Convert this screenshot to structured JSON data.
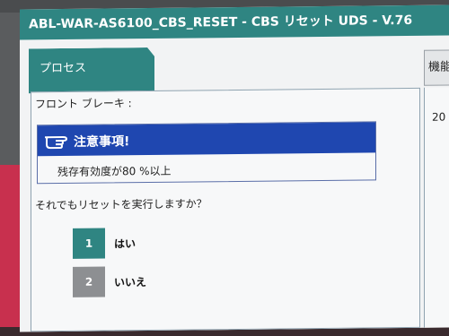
{
  "window": {
    "title": "ABL-WAR-AS6100_CBS_RESET - CBS リセット UDS - V.76"
  },
  "tabs": {
    "process_label": "プロセス",
    "right_tab_label": "機能"
  },
  "side_panel": {
    "value": "20"
  },
  "main": {
    "section_label": "フロント ブレーキ :",
    "warning": {
      "title": "注意事項!",
      "message": "残存有効度が80 %以上",
      "icon": "pointing-hand-icon"
    },
    "question": "それでもリセットを実行しますか？",
    "options": [
      {
        "number": "1",
        "label": "はい"
      },
      {
        "number": "2",
        "label": "いいえ"
      }
    ]
  },
  "colors": {
    "header_teal": "#2f8582",
    "warning_blue": "#1f47b0",
    "option_gray": "#8d8f92"
  }
}
